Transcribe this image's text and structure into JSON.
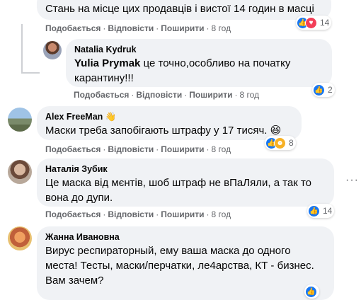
{
  "colors": {
    "bubble": "#f0f2f5",
    "meta": "#65676b",
    "like": "#1877f2",
    "love": "#f33e58",
    "haha": "#f7b125"
  },
  "actions": {
    "like": "Подобається",
    "reply": "Відповісти",
    "share": "Поширити",
    "dot": "·"
  },
  "comments": [
    {
      "text": "Стань на місце цих продавців і вистої 14 годин в масці",
      "time": "8 год",
      "reactions": {
        "count": "14",
        "icons": [
          "like-icon",
          "love-icon"
        ]
      }
    },
    {
      "author": "Natalia Kydruk",
      "mention": "Yulia Prymak",
      "text": " це точно,особливо на початку карантину!!!",
      "time": "8 год",
      "reactions": {
        "count": "2",
        "icons": [
          "like-icon"
        ]
      }
    },
    {
      "author": "Alex FreeMan",
      "author_badge": "wave-hand-icon",
      "text": "Маски треба запобігають штрафу у 17 тисяч.",
      "emoji": "😆",
      "time": "8 год",
      "reactions": {
        "count": "8",
        "icons": [
          "like-icon",
          "haha-icon"
        ]
      }
    },
    {
      "author": "Наталія Зубик",
      "text": "Це маска від мєнтів, шоб штраф не вПаЛяли, а так то вона до дупи.",
      "time": "8 год",
      "reactions": {
        "count": "14",
        "icons": [
          "like-icon"
        ]
      }
    },
    {
      "author": "Жанна Ивановна",
      "text": "Вирус респираторный, ему ваша маска до одного места! Тесты, маски/перчатки, ле4арства, КТ - бизнес. Вам зачем?"
    }
  ]
}
